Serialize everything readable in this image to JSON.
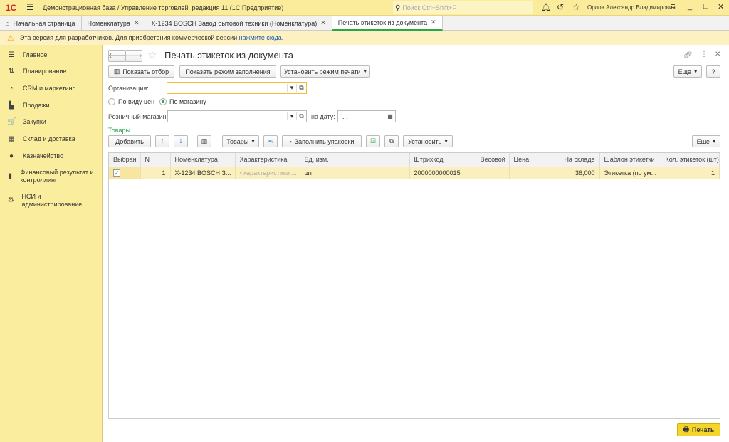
{
  "topbar": {
    "logo": "1С",
    "title": "Демонстрационная база / Управление торговлей, редакция 11  (1С:Предприятие)",
    "search_placeholder": "Поиск Ctrl+Shift+F",
    "user": "Орлов Александр Владимирович"
  },
  "tabs": [
    {
      "label": "Начальная страница"
    },
    {
      "label": "Номенклатура"
    },
    {
      "label": "X-1234 BOSCH Завод бытовой техники (Номенклатура)"
    },
    {
      "label": "Печать этикеток из документа"
    }
  ],
  "warning": {
    "text": "Эта версия для разработчиков. Для приобретения коммерческой версии",
    "link": "нажмите сюда",
    "end": "."
  },
  "sidebar": {
    "items": [
      {
        "label": "Главное",
        "icon": "☰"
      },
      {
        "label": "Планирование",
        "icon": "⇅"
      },
      {
        "label": "CRM и маркетинг",
        "icon": "◔"
      },
      {
        "label": "Продажи",
        "icon": "▙"
      },
      {
        "label": "Закупки",
        "icon": "🛒"
      },
      {
        "label": "Склад и доставка",
        "icon": "▦"
      },
      {
        "label": "Казначейство",
        "icon": "●"
      },
      {
        "label": "Финансовый результат и контроллинг",
        "icon": "▮"
      },
      {
        "label": "НСИ и администрирование",
        "icon": "⚙"
      }
    ]
  },
  "form": {
    "title": "Печать этикеток из документа",
    "show_filter": "Показать отбор",
    "show_fill_mode": "Показать режим заполнения",
    "set_print_mode": "Установить режим печати",
    "more": "Еще",
    "help": "?",
    "org_label": "Организация:",
    "org_value": "",
    "radio_price_type": "По виду цен",
    "radio_store": "По магазину",
    "store_label": "Розничный магазин:",
    "date_label": "на дату:",
    "date_value": " .  .",
    "goods_section": "Товары",
    "add": "Добавить",
    "goods_btn": "Товары",
    "fill_packages": "Заполнить упаковки",
    "set_btn": "Установить",
    "more2": "Еще",
    "print": "Печать"
  },
  "table": {
    "columns": [
      "Выбран",
      "N",
      "Номенклатура",
      "Характеристика",
      "Ед. изм.",
      "Штрихкод",
      "Весовой",
      "Цена",
      "На складе",
      "Шаблон этикетки",
      "Кол. этикеток (шт)"
    ],
    "rows": [
      {
        "selected": true,
        "n": "1",
        "item": "X-1234 BOSCH З...",
        "char": "<характеристики ...",
        "unit": "шт",
        "barcode": "2000000000015",
        "weight": "",
        "price": "",
        "stock": "36,000",
        "template": "Этикетка (по ум...",
        "qty": "1"
      }
    ]
  },
  "colors": {
    "accent": "#fbec9c",
    "green": "#28a745",
    "print_btn": "#f5d52b"
  }
}
